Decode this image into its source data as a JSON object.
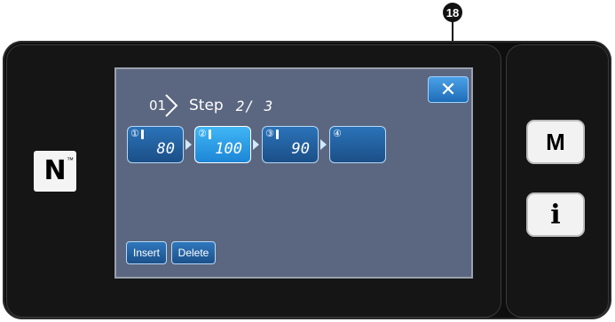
{
  "callout": {
    "number": "18"
  },
  "device": {
    "nfc_symbol": "N",
    "nfc_tm": "™",
    "m_button": "M",
    "info_button": "i"
  },
  "screen": {
    "pattern_number": "01",
    "step_label": "Step",
    "step_value": "2/ 3",
    "close_label": "✕",
    "steps": [
      {
        "index": "①",
        "value": "80",
        "selected": false
      },
      {
        "index": "②",
        "value": "100",
        "selected": true
      },
      {
        "index": "③",
        "value": "90",
        "selected": false
      },
      {
        "index": "④",
        "value": "",
        "selected": false
      }
    ],
    "insert_label": "Insert",
    "delete_label": "Delete"
  },
  "colors": {
    "screen_bg": "#5b6780",
    "button_blue": "#1f6cb8",
    "button_selected": "#2fa4ee"
  }
}
